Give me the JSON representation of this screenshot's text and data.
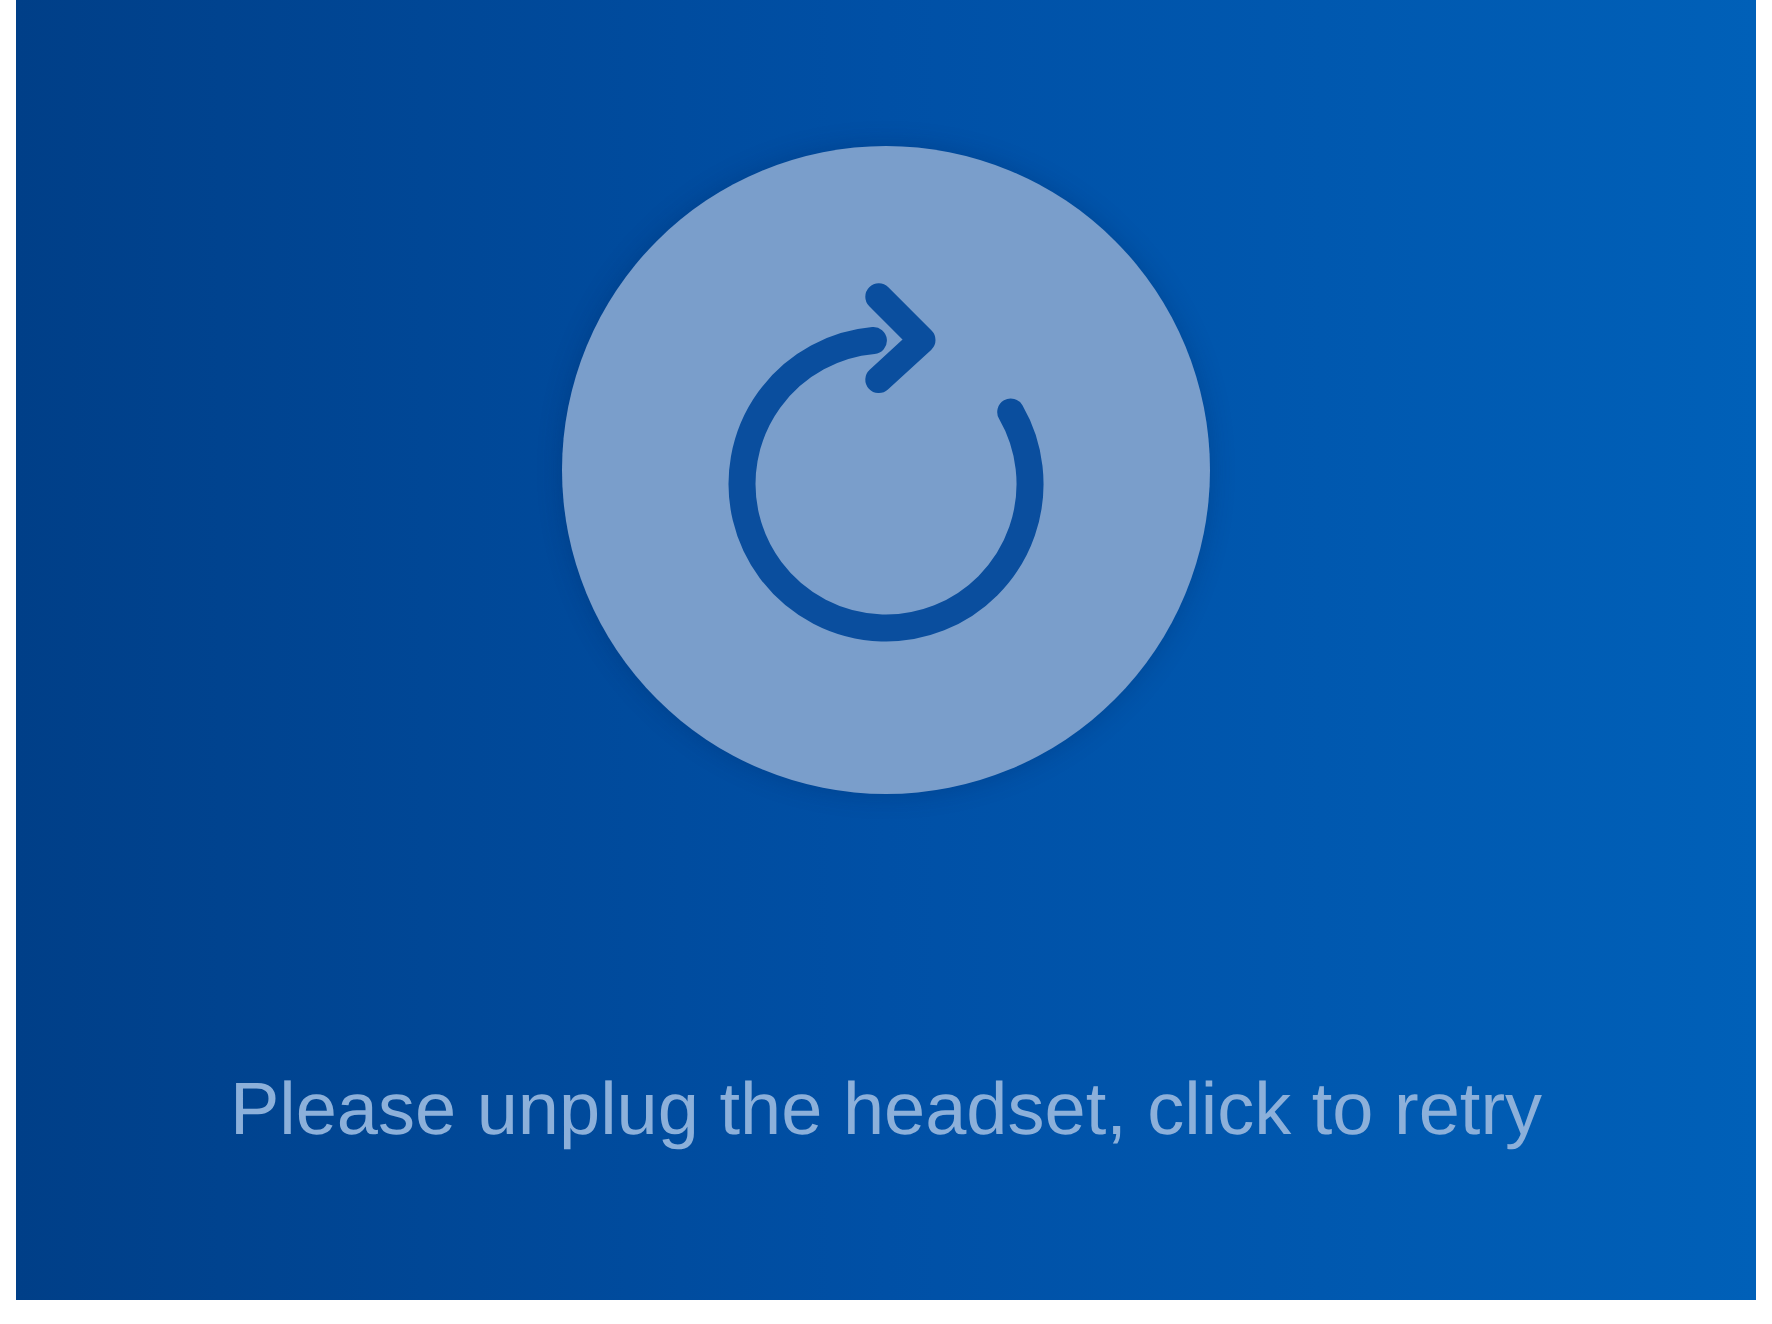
{
  "message": "Please unplug the headset, click to retry"
}
